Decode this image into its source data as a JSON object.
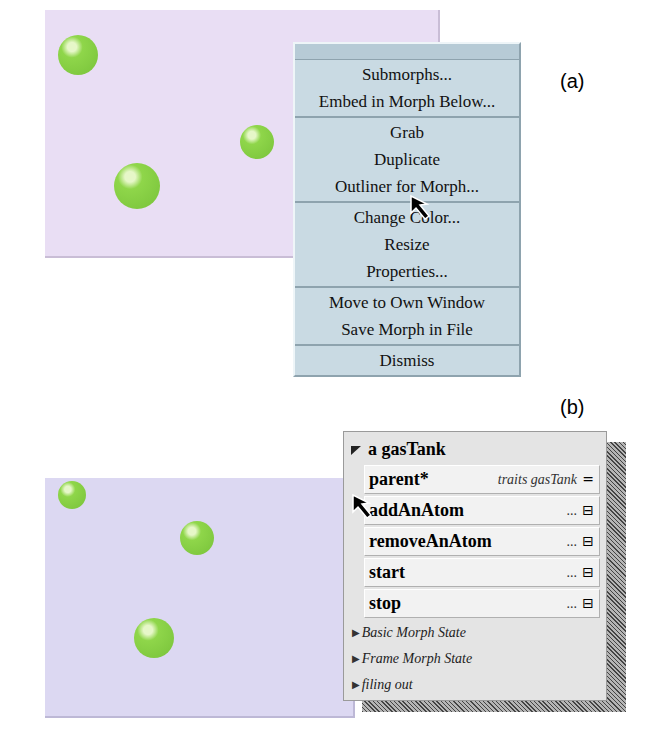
{
  "panels": [
    {
      "label": "(a)"
    },
    {
      "label": "(b)"
    }
  ],
  "menu": {
    "groups": [
      [
        "Submorphs...",
        "Embed in Morph Below..."
      ],
      [
        "Grab",
        "Duplicate",
        "Outliner for Morph..."
      ],
      [
        "Change Color...",
        "Resize",
        "Properties..."
      ],
      [
        "Move to Own Window",
        "Save Morph in File"
      ],
      [
        "Dismiss"
      ]
    ]
  },
  "outliner": {
    "title": "a gasTank",
    "slots": [
      {
        "name": "parent*",
        "value": "traits gasTank",
        "button": "="
      },
      {
        "name": "addAnAtom",
        "value": "...",
        "button": "⊟"
      },
      {
        "name": "removeAnAtom",
        "value": "...",
        "button": "⊟"
      },
      {
        "name": "start",
        "value": "...",
        "button": "⊟"
      },
      {
        "name": "stop",
        "value": "...",
        "button": "⊟"
      }
    ],
    "categories": [
      {
        "expander": "▶",
        "label": "Basic Morph State"
      },
      {
        "expander": "▶",
        "label": "Frame Morph State"
      },
      {
        "expander": "▶",
        "label": "filing out"
      }
    ]
  }
}
